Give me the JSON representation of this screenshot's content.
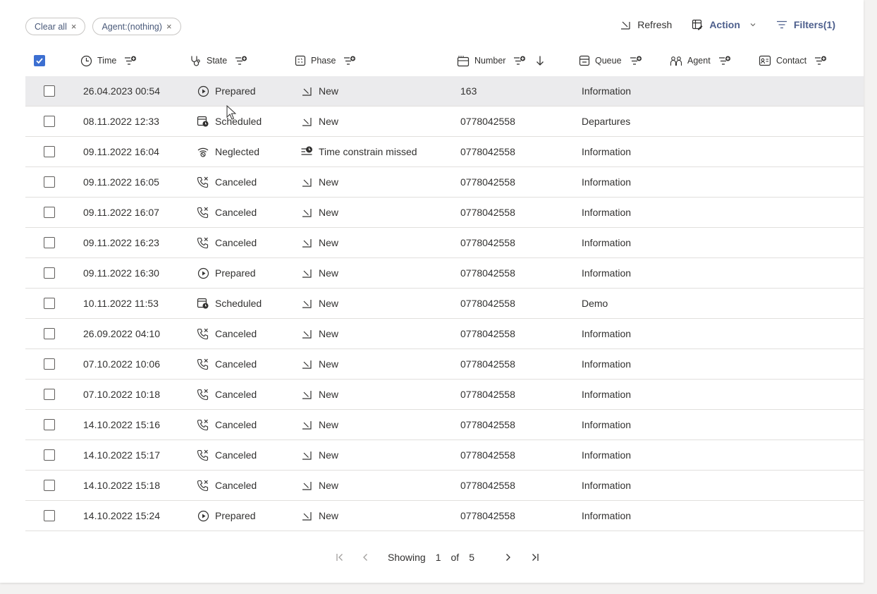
{
  "filters": {
    "chips": [
      {
        "label": "Clear all"
      },
      {
        "label": "Agent:(nothing)"
      }
    ]
  },
  "toolbar": {
    "refresh_label": "Refresh",
    "action_label": "Action",
    "filters_label": "Filters(1)"
  },
  "columns": {
    "time": "Time",
    "state": "State",
    "phase": "Phase",
    "number": "Number",
    "queue": "Queue",
    "agent": "Agent",
    "contact": "Contact"
  },
  "header_checkbox_checked": true,
  "rows": [
    {
      "time": "26.04.2023 00:54",
      "state": "Prepared",
      "state_icon": "play-circle-icon",
      "phase": "New",
      "phase_icon": "phase-new-icon",
      "number": "163",
      "queue": "Information",
      "selected": true
    },
    {
      "time": "08.11.2022 12:33",
      "state": "Scheduled",
      "state_icon": "calendar-clock-icon",
      "phase": "New",
      "phase_icon": "phase-new-icon",
      "number": "0778042558",
      "queue": "Departures"
    },
    {
      "time": "09.11.2022 16:04",
      "state": "Neglected",
      "state_icon": "neglected-icon",
      "phase": "Time constrain missed",
      "phase_icon": "time-missed-icon",
      "number": "0778042558",
      "queue": "Information"
    },
    {
      "time": "09.11.2022 16:05",
      "state": "Canceled",
      "state_icon": "call-cancel-icon",
      "phase": "New",
      "phase_icon": "phase-new-icon",
      "number": "0778042558",
      "queue": "Information"
    },
    {
      "time": "09.11.2022 16:07",
      "state": "Canceled",
      "state_icon": "call-cancel-icon",
      "phase": "New",
      "phase_icon": "phase-new-icon",
      "number": "0778042558",
      "queue": "Information"
    },
    {
      "time": "09.11.2022 16:23",
      "state": "Canceled",
      "state_icon": "call-cancel-icon",
      "phase": "New",
      "phase_icon": "phase-new-icon",
      "number": "0778042558",
      "queue": "Information"
    },
    {
      "time": "09.11.2022 16:30",
      "state": "Prepared",
      "state_icon": "play-circle-icon",
      "phase": "New",
      "phase_icon": "phase-new-icon",
      "number": "0778042558",
      "queue": "Information"
    },
    {
      "time": "10.11.2022 11:53",
      "state": "Scheduled",
      "state_icon": "calendar-clock-icon",
      "phase": "New",
      "phase_icon": "phase-new-icon",
      "number": "0778042558",
      "queue": "Demo"
    },
    {
      "time": "26.09.2022 04:10",
      "state": "Canceled",
      "state_icon": "call-cancel-icon",
      "phase": "New",
      "phase_icon": "phase-new-icon",
      "number": "0778042558",
      "queue": "Information"
    },
    {
      "time": "07.10.2022 10:06",
      "state": "Canceled",
      "state_icon": "call-cancel-icon",
      "phase": "New",
      "phase_icon": "phase-new-icon",
      "number": "0778042558",
      "queue": "Information"
    },
    {
      "time": "07.10.2022 10:18",
      "state": "Canceled",
      "state_icon": "call-cancel-icon",
      "phase": "New",
      "phase_icon": "phase-new-icon",
      "number": "0778042558",
      "queue": "Information"
    },
    {
      "time": "14.10.2022 15:16",
      "state": "Canceled",
      "state_icon": "call-cancel-icon",
      "phase": "New",
      "phase_icon": "phase-new-icon",
      "number": "0778042558",
      "queue": "Information"
    },
    {
      "time": "14.10.2022 15:17",
      "state": "Canceled",
      "state_icon": "call-cancel-icon",
      "phase": "New",
      "phase_icon": "phase-new-icon",
      "number": "0778042558",
      "queue": "Information"
    },
    {
      "time": "14.10.2022 15:18",
      "state": "Canceled",
      "state_icon": "call-cancel-icon",
      "phase": "New",
      "phase_icon": "phase-new-icon",
      "number": "0778042558",
      "queue": "Information"
    },
    {
      "time": "14.10.2022 15:24",
      "state": "Prepared",
      "state_icon": "play-circle-icon",
      "phase": "New",
      "phase_icon": "phase-new-icon",
      "number": "0778042558",
      "queue": "Information"
    }
  ],
  "pagination": {
    "showing_label": "Showing",
    "current_page": "1",
    "of_label": "of",
    "total_pages": "5"
  },
  "colors": {
    "accent": "#3c6fd1",
    "toolbar_strong": "#4c5e8c",
    "selected_row": "#ebebed"
  }
}
